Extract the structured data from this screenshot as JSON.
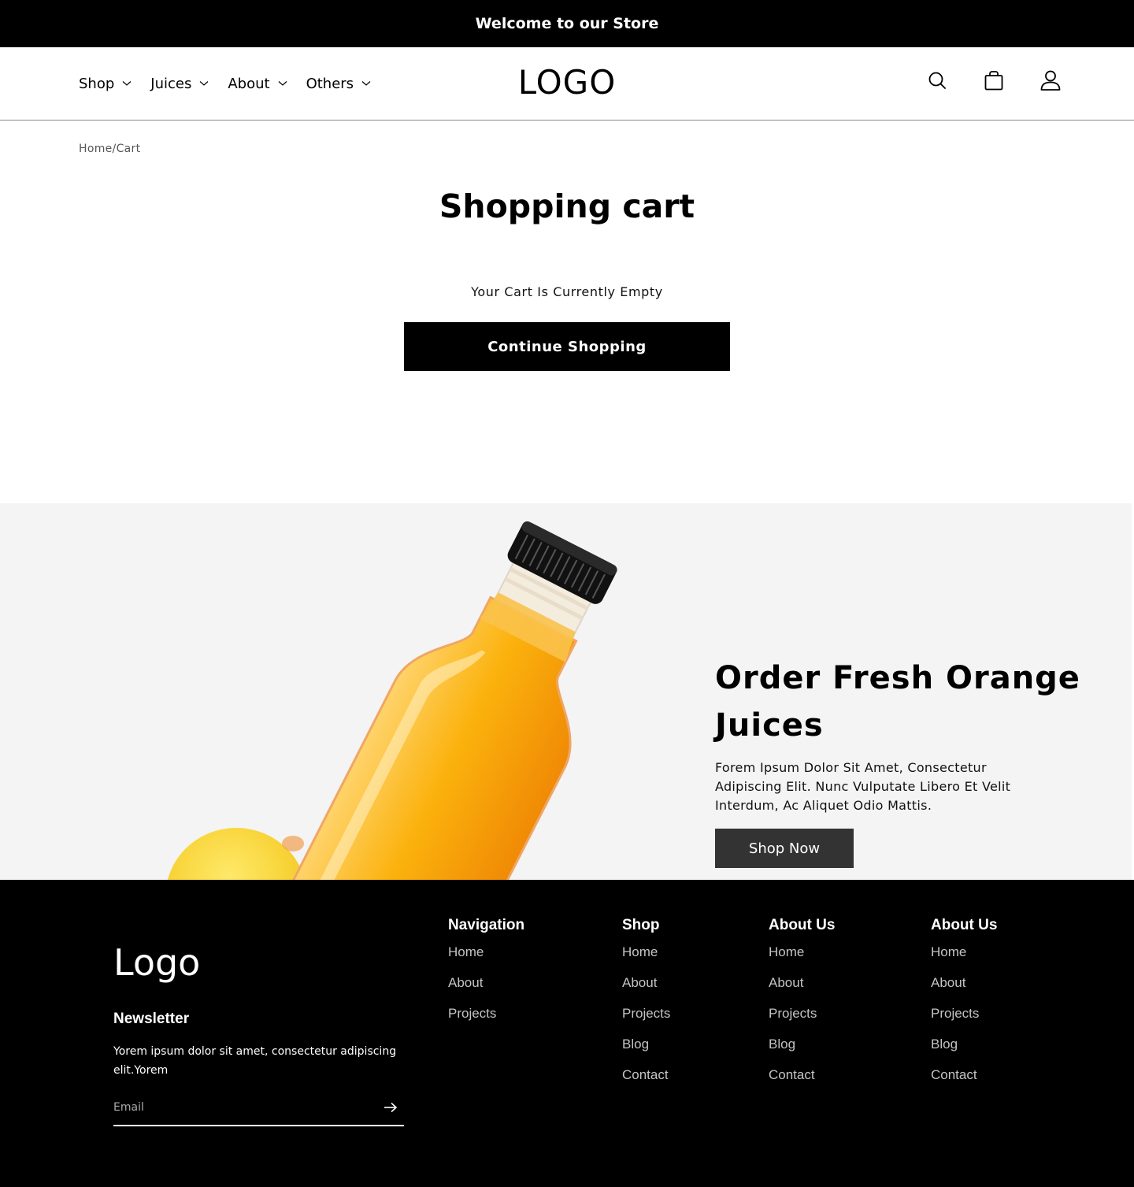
{
  "announcement": {
    "text": "Welcome to our Store"
  },
  "header": {
    "nav": [
      {
        "label": "Shop"
      },
      {
        "label": "Juices"
      },
      {
        "label": "About"
      },
      {
        "label": "Others"
      }
    ],
    "logo": "LOGO",
    "icons": [
      "search-icon",
      "bag-icon",
      "user-icon"
    ]
  },
  "breadcrumb": {
    "home": "Home",
    "separator": "/",
    "current": "Cart"
  },
  "cart": {
    "title": "Shopping cart",
    "empty_message": "Your Cart Is Currently Empty",
    "continue_label": "Continue Shopping"
  },
  "promo": {
    "title": "Order Fresh Orange Juices",
    "text": "Forem Ipsum Dolor Sit Amet, Consectetur Adipiscing Elit. Nunc Vulputate Libero Et Velit Interdum, Ac Aliquet Odio Mattis.",
    "button_label": "Shop Now"
  },
  "footer": {
    "logo": "Logo",
    "newsletter": {
      "title": "Newsletter",
      "text": "Yorem ipsum dolor sit amet, consectetur adipiscing elit.Yorem",
      "email_placeholder": "Email"
    },
    "columns": [
      {
        "title": "Navigation",
        "links": [
          "Home",
          "About",
          "Projects"
        ]
      },
      {
        "title": "Shop",
        "links": [
          "Home",
          "About",
          "Projects",
          "Blog",
          "Contact"
        ]
      },
      {
        "title": "About Us",
        "links": [
          "Home",
          "About",
          "Projects",
          "Blog",
          "Contact"
        ]
      },
      {
        "title": "About Us",
        "links": [
          "Home",
          "About",
          "Projects",
          "Blog",
          "Contact"
        ]
      }
    ]
  },
  "colors": {
    "primary": "#000000",
    "promo_bg": "#f4f4f4",
    "shop_now_bg": "#333333",
    "juice": "#f7a80e"
  }
}
